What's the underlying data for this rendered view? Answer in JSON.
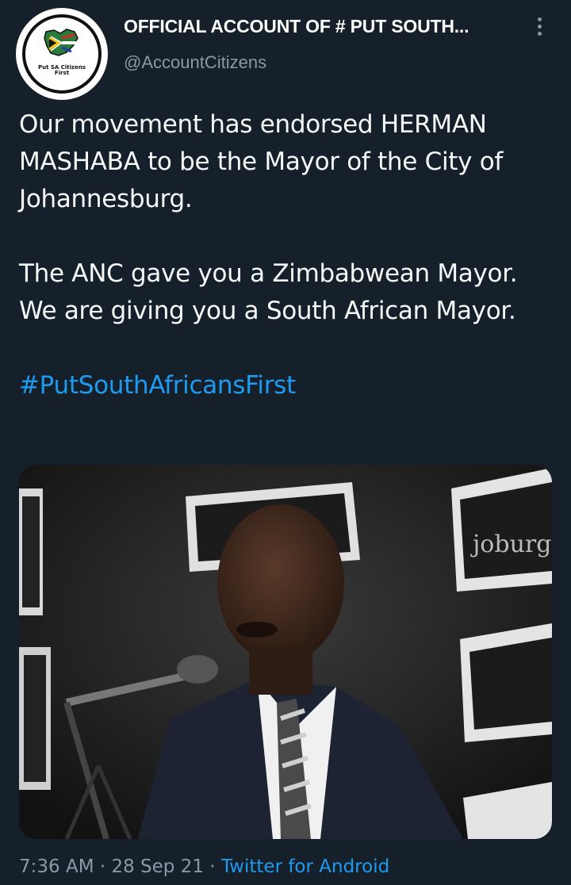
{
  "account": {
    "display_name": "OFFICIAL ACCOUNT OF # PUT SOUTH...",
    "handle": "@AccountCitizens",
    "avatar_text": "Put SA Citizens First"
  },
  "tweet": {
    "paragraph1": "Our movement has endorsed HERMAN MASHABA to be the Mayor of the City of Johannesburg.",
    "paragraph2": "The ANC gave you a Zimbabwean Mayor. We are giving you a South African Mayor.",
    "hashtag": "#PutSouthAfricansFirst",
    "backdrop_text": "joburg"
  },
  "meta": {
    "time": "7:36 AM",
    "separator1": " · ",
    "date": "28 Sep 21",
    "separator2": " · ",
    "source": "Twitter for Android"
  },
  "colors": {
    "background": "#15202b",
    "text": "#f7f9f9",
    "secondary": "#8b98a5",
    "link": "#1d9bf0"
  }
}
